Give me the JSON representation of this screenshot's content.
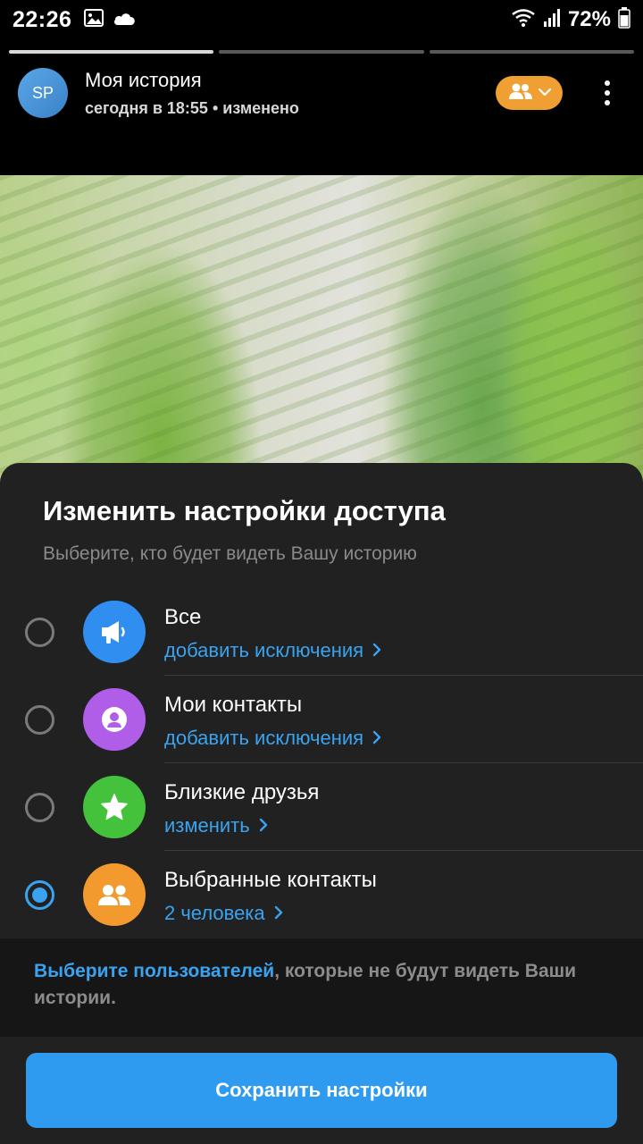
{
  "status_bar": {
    "time": "22:26",
    "battery": "72%",
    "left_icons": [
      "image-icon",
      "cloud-icon"
    ],
    "right_icons": [
      "wifi-icon",
      "signal-icon",
      "battery-icon"
    ]
  },
  "story": {
    "progress_segments": 3,
    "active_segment": 1,
    "avatar_initials": "SP",
    "title": "Моя история",
    "subtitle": "сегодня в 18:55 • изменено",
    "privacy_pill_icons": [
      "group-icon",
      "chevron-down-icon"
    ],
    "privacy_pill_color": "#f0a032"
  },
  "sheet": {
    "title": "Изменить настройки доступа",
    "subtitle": "Выберите, кто будет видеть Вашу историю",
    "options": [
      {
        "label": "Все",
        "action": "добавить исключения",
        "icon": "megaphone-icon",
        "color": "#2f8ef0",
        "selected": false
      },
      {
        "label": "Мои контакты",
        "action": "добавить исключения",
        "icon": "person-icon",
        "color": "#b05ee8",
        "selected": false
      },
      {
        "label": "Близкие друзья",
        "action": "изменить",
        "icon": "star-icon",
        "color": "#44c23c",
        "selected": false
      },
      {
        "label": "Выбранные контакты",
        "action": "2 человека",
        "icon": "group-icon",
        "color": "#f29a2e",
        "selected": true
      }
    ],
    "info_link": "Выберите пользователей",
    "info_rest": ", которые не будут видеть Ваши истории.",
    "save_label": "Сохранить настройки",
    "accent_color": "#3aa3f0"
  }
}
